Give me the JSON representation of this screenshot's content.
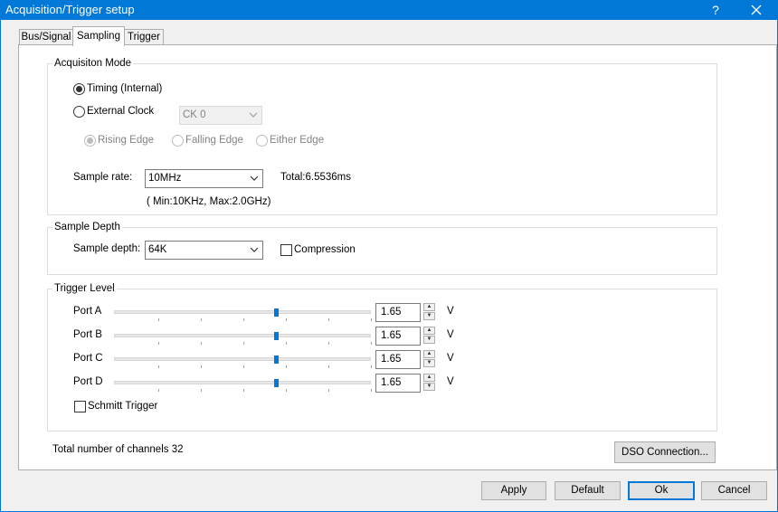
{
  "window": {
    "title": "Acquisition/Trigger setup",
    "help_label": "?",
    "close_icon": "close-icon"
  },
  "tabs": [
    {
      "label": "Bus/Signal",
      "active": false
    },
    {
      "label": "Sampling",
      "active": true
    },
    {
      "label": "Trigger",
      "active": false
    }
  ],
  "acquisition": {
    "group_label": "Acquisiton Mode",
    "timing_label": "Timing (Internal)",
    "timing_selected": true,
    "external_label": "External Clock",
    "external_selected": false,
    "clock_select": {
      "value": "CK 0",
      "enabled": false
    },
    "edges": [
      {
        "label": "Rising Edge",
        "selected": true,
        "enabled": false
      },
      {
        "label": "Falling Edge",
        "selected": false,
        "enabled": false
      },
      {
        "label": "Either Edge",
        "selected": false,
        "enabled": false
      }
    ],
    "sample_rate_label": "Sample rate:",
    "sample_rate_value": "10MHz",
    "total_text": "Total:6.5536ms",
    "range_text": "( Min:10KHz, Max:2.0GHz)"
  },
  "depth": {
    "group_label": "Sample Depth",
    "sample_depth_label": "Sample depth:",
    "sample_depth_value": "64K",
    "compression_label": "Compression",
    "compression_checked": false
  },
  "trigger": {
    "group_label": "Trigger Level",
    "unit": "V",
    "ports": [
      {
        "label": "Port A",
        "value": "1.65",
        "level_fraction": 0.63
      },
      {
        "label": "Port B",
        "value": "1.65",
        "level_fraction": 0.63
      },
      {
        "label": "Port C",
        "value": "1.65",
        "level_fraction": 0.63
      },
      {
        "label": "Port D",
        "value": "1.65",
        "level_fraction": 0.63
      }
    ],
    "schmitt_label": "Schmitt Trigger",
    "schmitt_checked": false
  },
  "footer": {
    "channels_text": "Total number of channels 32",
    "dso_button": "DSO Connection..."
  },
  "buttons": {
    "apply": "Apply",
    "default": "Default",
    "ok": "Ok",
    "cancel": "Cancel"
  }
}
